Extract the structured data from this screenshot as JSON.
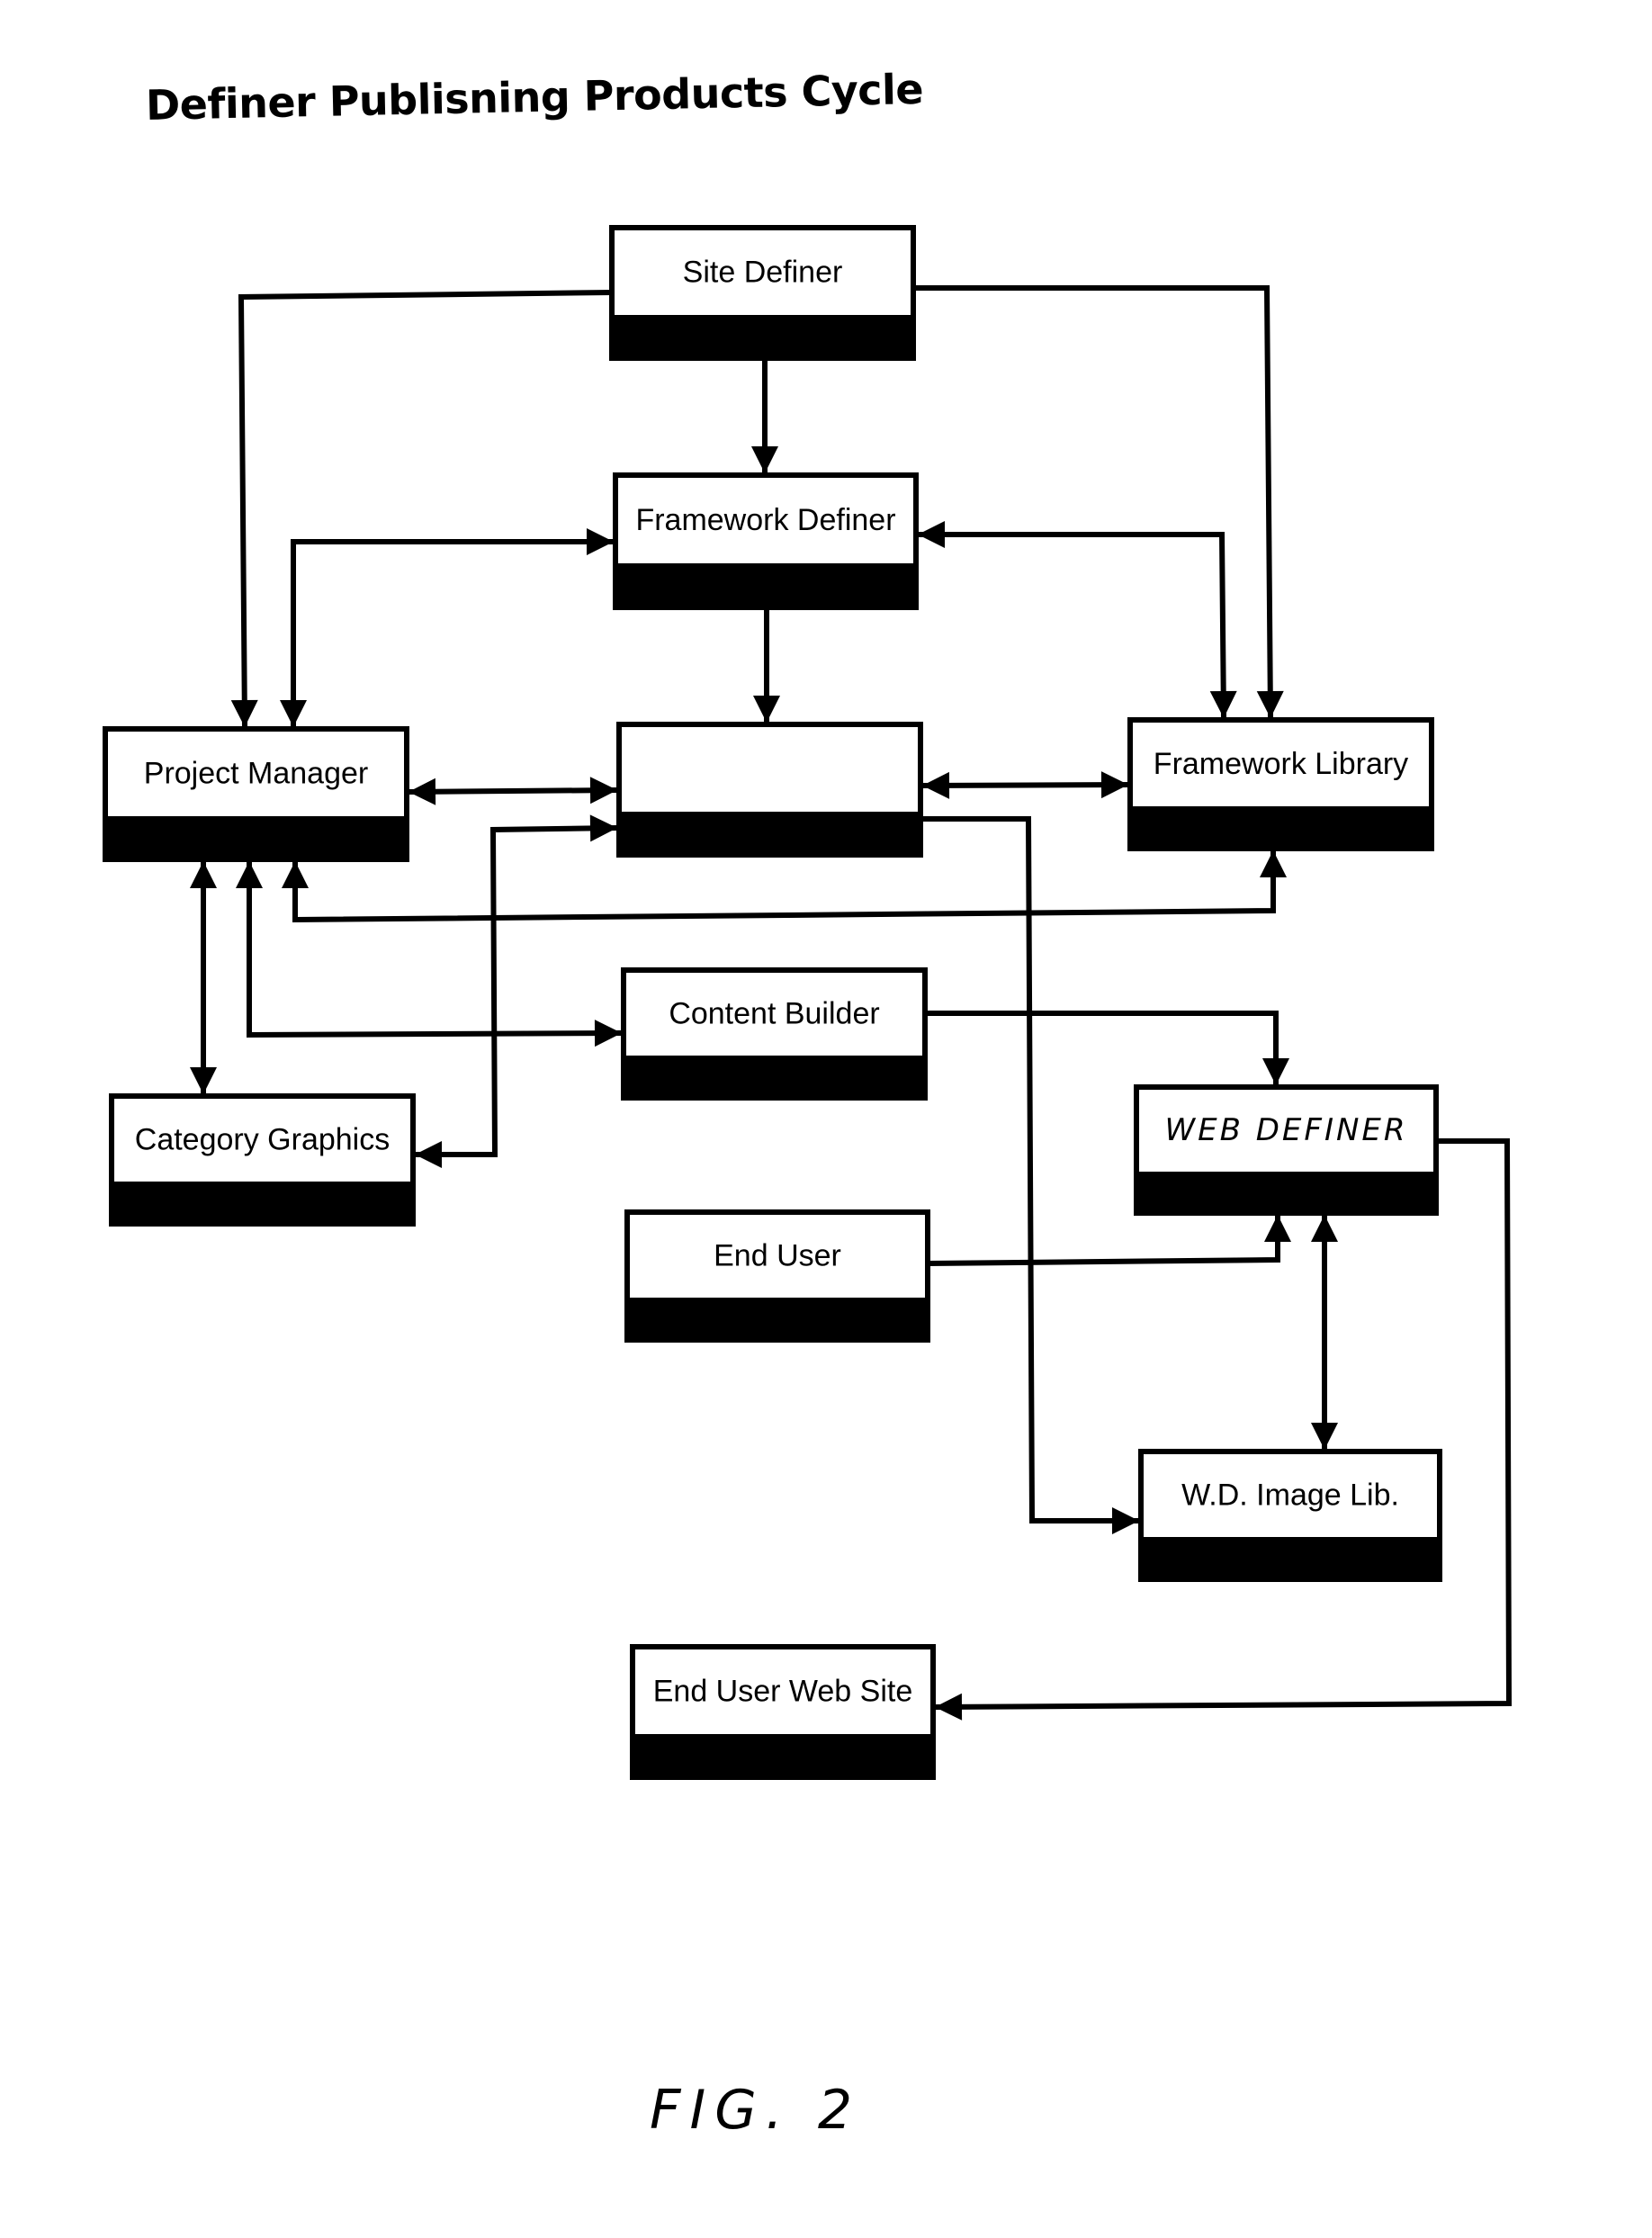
{
  "title": "Definer Publisning Products Cycle",
  "figure_label": "FIG. 2",
  "nodes": {
    "site_definer": {
      "label": "Site Definer"
    },
    "framework_definer": {
      "label": "Framework Definer"
    },
    "project_manager": {
      "label": "Project Manager"
    },
    "unlabeled_center": {
      "label": ""
    },
    "framework_library": {
      "label": "Framework Library"
    },
    "content_builder": {
      "label": "Content Builder"
    },
    "category_graphics": {
      "label": "Category Graphics"
    },
    "web_definer": {
      "label": "WEB DEFINER"
    },
    "end_user": {
      "label": "End User"
    },
    "wd_image_lib": {
      "label": "W.D. Image Lib."
    },
    "end_user_web_site": {
      "label": "End User Web Site"
    }
  },
  "edges": [
    {
      "from": "site_definer",
      "to": "framework_definer",
      "direction": "forward"
    },
    {
      "from": "site_definer",
      "to": "project_manager",
      "direction": "forward"
    },
    {
      "from": "site_definer",
      "to": "framework_library",
      "direction": "forward"
    },
    {
      "from": "project_manager",
      "to": "framework_definer",
      "direction": "both"
    },
    {
      "from": "framework_library",
      "to": "framework_definer",
      "direction": "both"
    },
    {
      "from": "framework_definer",
      "to": "unlabeled_center",
      "direction": "forward"
    },
    {
      "from": "project_manager",
      "to": "unlabeled_center",
      "direction": "both"
    },
    {
      "from": "unlabeled_center",
      "to": "framework_library",
      "direction": "both"
    },
    {
      "from": "framework_library",
      "to": "project_manager",
      "direction": "both"
    },
    {
      "from": "project_manager",
      "to": "category_graphics",
      "direction": "both"
    },
    {
      "from": "project_manager",
      "to": "content_builder",
      "direction": "both"
    },
    {
      "from": "category_graphics",
      "to": "unlabeled_center",
      "direction": "both"
    },
    {
      "from": "content_builder",
      "to": "web_definer",
      "direction": "forward"
    },
    {
      "from": "end_user",
      "to": "web_definer",
      "direction": "forward"
    },
    {
      "from": "web_definer",
      "to": "wd_image_lib",
      "direction": "both"
    },
    {
      "from": "unlabeled_center",
      "to": "wd_image_lib",
      "direction": "forward"
    },
    {
      "from": "web_definer",
      "to": "end_user_web_site",
      "direction": "forward"
    }
  ]
}
